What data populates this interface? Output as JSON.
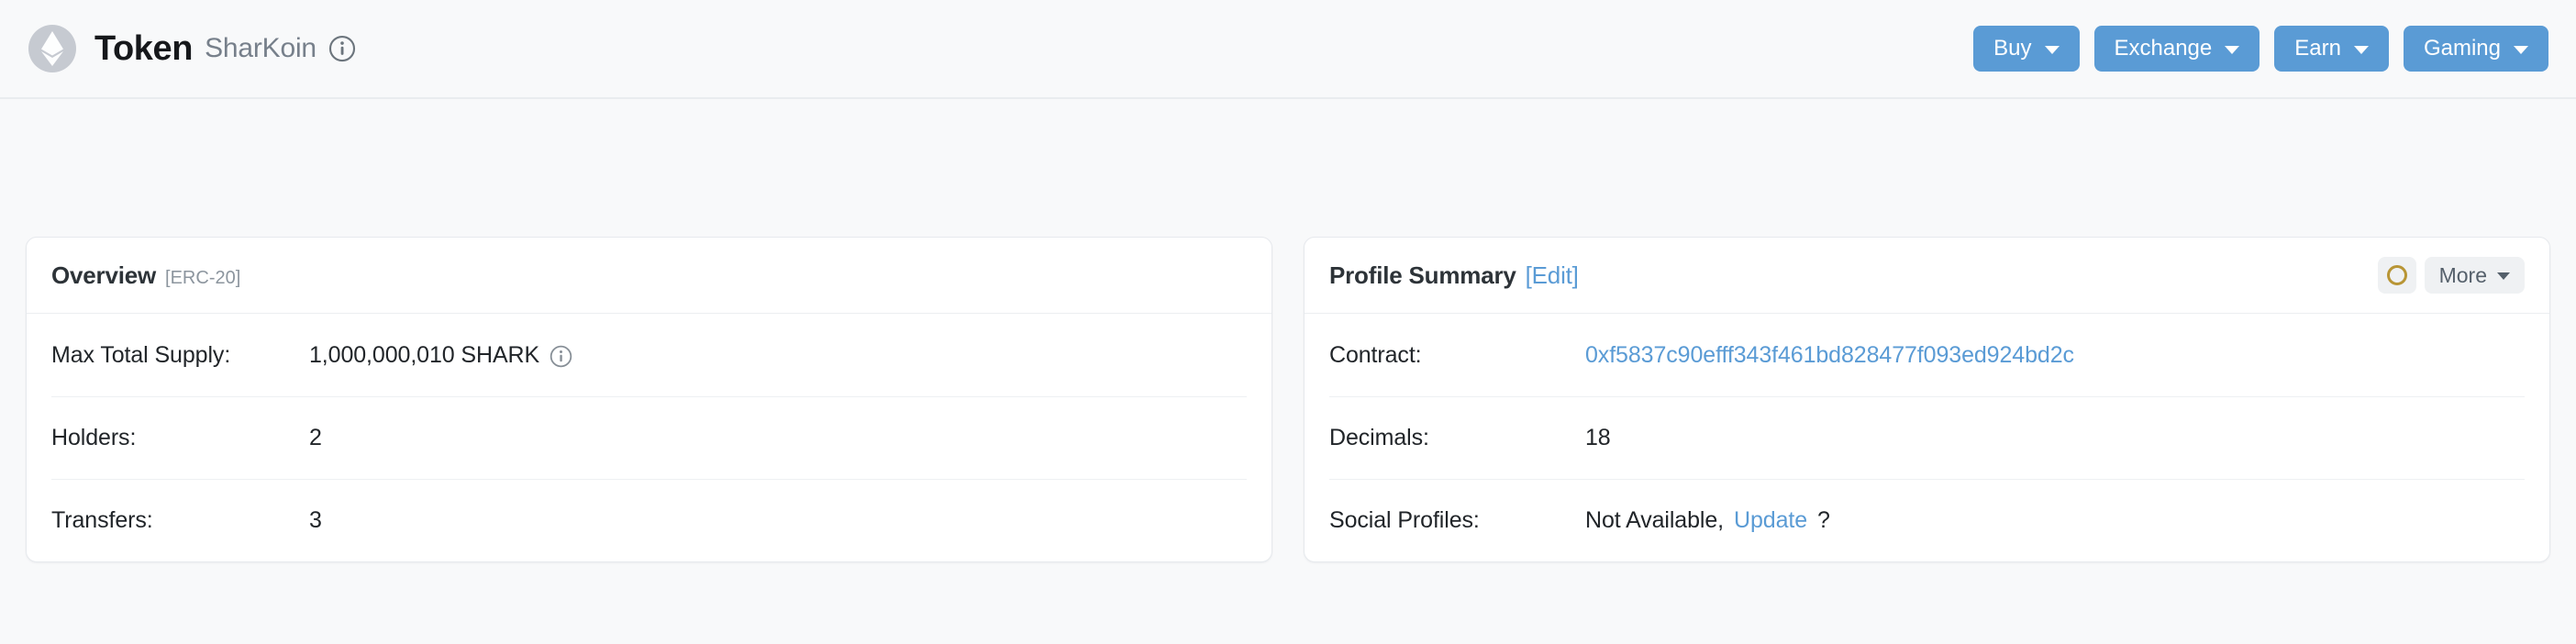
{
  "header": {
    "logo_icon": "ethereum-diamond-icon",
    "title": "Token",
    "subtitle": "SharKoin",
    "info_icon": "info-circle-icon",
    "actions": [
      {
        "label": "Buy",
        "icon": "chevron-down-icon"
      },
      {
        "label": "Exchange",
        "icon": "chevron-down-icon"
      },
      {
        "label": "Earn",
        "icon": "chevron-down-icon"
      },
      {
        "label": "Gaming",
        "icon": "chevron-down-icon"
      }
    ],
    "accent_color": "#5a9bd5"
  },
  "overview_card": {
    "heading": "Overview",
    "tag": "[ERC-20]",
    "rows": [
      {
        "label": "Max Total Supply:",
        "value": "1,000,000,010 SHARK",
        "icon": "info-circle-icon"
      },
      {
        "label": "Holders:",
        "value": "2"
      },
      {
        "label": "Transfers:",
        "value": "3"
      }
    ]
  },
  "profile_card": {
    "heading": "Profile Summary",
    "edit_label": "[Edit]",
    "coin_icon": "coin-ring-icon",
    "more_label": "More",
    "more_icon": "chevron-down-icon",
    "rows": {
      "contract_label": "Contract:",
      "contract_value": "0xf5837c90efff343f461bd828477f093ed924bd2c",
      "decimals_label": "Decimals:",
      "decimals_value": "18",
      "social_label": "Social Profiles:",
      "social_prefix": "Not Available,",
      "social_link": "Update",
      "social_suffix": "?"
    }
  },
  "colors": {
    "link": "#5a9bd5",
    "page_bg": "#f8f9fa",
    "card_bg": "#ffffff",
    "coin_gold": "#b89535"
  }
}
